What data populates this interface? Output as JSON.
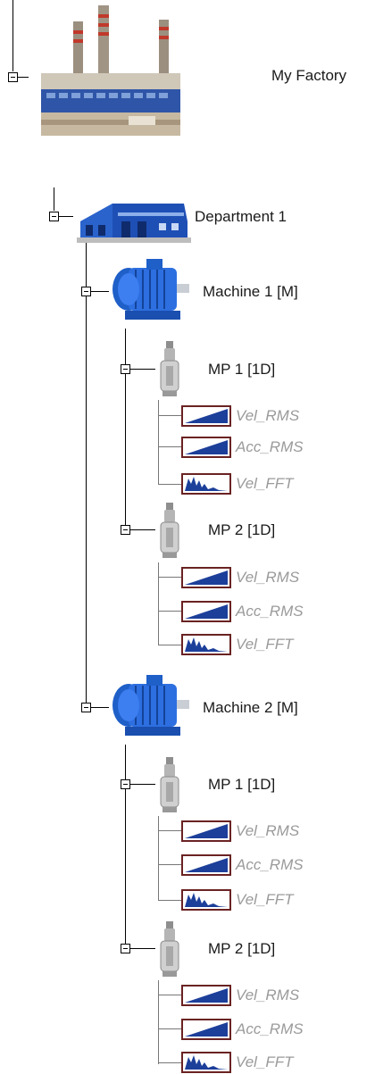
{
  "root": {
    "label": "My Factory",
    "icon": "factory-icon"
  },
  "department": {
    "label": "Department 1",
    "icon": "building-icon"
  },
  "machines": [
    {
      "label": "Machine 1 [M]",
      "icon": "motor-icon",
      "points": [
        {
          "label": "MP 1 [1D]",
          "icon": "sensor-icon",
          "signals": [
            {
              "label": "Vel_RMS",
              "icon": "trend-chart-icon"
            },
            {
              "label": "Acc_RMS",
              "icon": "trend-chart-icon"
            },
            {
              "label": "Vel_FFT",
              "icon": "spectrum-chart-icon"
            }
          ]
        },
        {
          "label": "MP 2 [1D]",
          "icon": "sensor-icon",
          "signals": [
            {
              "label": "Vel_RMS",
              "icon": "trend-chart-icon"
            },
            {
              "label": "Acc_RMS",
              "icon": "trend-chart-icon"
            },
            {
              "label": "Vel_FFT",
              "icon": "spectrum-chart-icon"
            }
          ]
        }
      ]
    },
    {
      "label": "Machine 2 [M]",
      "icon": "motor-icon",
      "points": [
        {
          "label": "MP 1 [1D]",
          "icon": "sensor-icon",
          "signals": [
            {
              "label": "Vel_RMS",
              "icon": "trend-chart-icon"
            },
            {
              "label": "Acc_RMS",
              "icon": "trend-chart-icon"
            },
            {
              "label": "Vel_FFT",
              "icon": "spectrum-chart-icon"
            }
          ]
        },
        {
          "label": "MP 2 [1D]",
          "icon": "sensor-icon",
          "signals": [
            {
              "label": "Vel_RMS",
              "icon": "trend-chart-icon"
            },
            {
              "label": "Acc_RMS",
              "icon": "trend-chart-icon"
            },
            {
              "label": "Vel_FFT",
              "icon": "spectrum-chart-icon"
            }
          ]
        }
      ]
    }
  ],
  "colors": {
    "chart_border": "#6a2222",
    "chart_fill": "#1c3f9a",
    "motor_blue": "#1f5fc8",
    "leaf_text": "#9a9a9a"
  }
}
